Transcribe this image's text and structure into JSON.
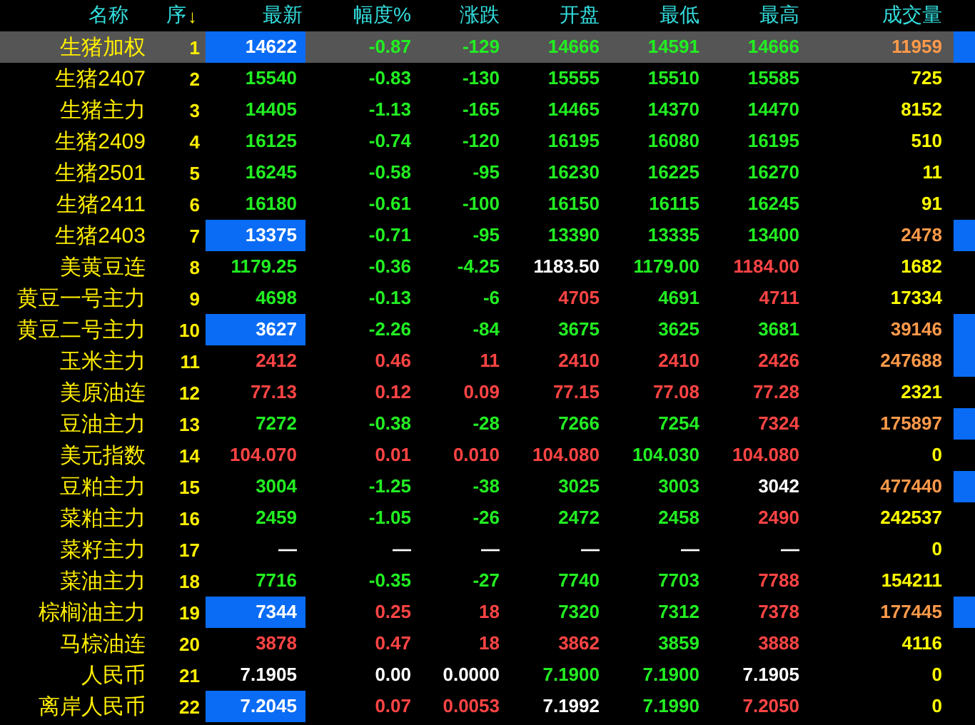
{
  "columns": [
    {
      "kind": "name",
      "label": "名称"
    },
    {
      "kind": "seq",
      "label": "序",
      "sort_arrow": "↓"
    },
    {
      "kind": "num",
      "label": "最新"
    },
    {
      "kind": "num",
      "label": "幅度%"
    },
    {
      "kind": "num",
      "label": "涨跌"
    },
    {
      "kind": "num",
      "label": "开盘"
    },
    {
      "kind": "num",
      "label": "最低"
    },
    {
      "kind": "num",
      "label": "最高"
    },
    {
      "kind": "num",
      "label": "成交量"
    }
  ],
  "rows": [
    {
      "name": "生猪加权",
      "seq": "1",
      "selected": true,
      "highlighted": true,
      "flagged": true,
      "cells": [
        {
          "text": "14622",
          "color": "#ffffff"
        },
        {
          "text": "-0.87",
          "color": "#22ee22"
        },
        {
          "text": "-129",
          "color": "#22ee22"
        },
        {
          "text": "14666",
          "color": "#22ee22"
        },
        {
          "text": "14591",
          "color": "#22ee22"
        },
        {
          "text": "14666",
          "color": "#22ee22"
        },
        {
          "text": "11959",
          "color": "#ff9a4a"
        }
      ]
    },
    {
      "name": "生猪2407",
      "seq": "2",
      "selected": false,
      "highlighted": false,
      "flagged": false,
      "cells": [
        {
          "text": "15540",
          "color": "#22ee22"
        },
        {
          "text": "-0.83",
          "color": "#22ee22"
        },
        {
          "text": "-130",
          "color": "#22ee22"
        },
        {
          "text": "15555",
          "color": "#22ee22"
        },
        {
          "text": "15510",
          "color": "#22ee22"
        },
        {
          "text": "15585",
          "color": "#22ee22"
        },
        {
          "text": "725",
          "color": "#ffff00"
        }
      ]
    },
    {
      "name": "生猪主力",
      "seq": "3",
      "selected": false,
      "highlighted": false,
      "flagged": false,
      "cells": [
        {
          "text": "14405",
          "color": "#22ee22"
        },
        {
          "text": "-1.13",
          "color": "#22ee22"
        },
        {
          "text": "-165",
          "color": "#22ee22"
        },
        {
          "text": "14465",
          "color": "#22ee22"
        },
        {
          "text": "14370",
          "color": "#22ee22"
        },
        {
          "text": "14470",
          "color": "#22ee22"
        },
        {
          "text": "8152",
          "color": "#ffff00"
        }
      ]
    },
    {
      "name": "生猪2409",
      "seq": "4",
      "selected": false,
      "highlighted": false,
      "flagged": false,
      "cells": [
        {
          "text": "16125",
          "color": "#22ee22"
        },
        {
          "text": "-0.74",
          "color": "#22ee22"
        },
        {
          "text": "-120",
          "color": "#22ee22"
        },
        {
          "text": "16195",
          "color": "#22ee22"
        },
        {
          "text": "16080",
          "color": "#22ee22"
        },
        {
          "text": "16195",
          "color": "#22ee22"
        },
        {
          "text": "510",
          "color": "#ffff00"
        }
      ]
    },
    {
      "name": "生猪2501",
      "seq": "5",
      "selected": false,
      "highlighted": false,
      "flagged": false,
      "cells": [
        {
          "text": "16245",
          "color": "#22ee22"
        },
        {
          "text": "-0.58",
          "color": "#22ee22"
        },
        {
          "text": "-95",
          "color": "#22ee22"
        },
        {
          "text": "16230",
          "color": "#22ee22"
        },
        {
          "text": "16225",
          "color": "#22ee22"
        },
        {
          "text": "16270",
          "color": "#22ee22"
        },
        {
          "text": "11",
          "color": "#ffff00"
        }
      ]
    },
    {
      "name": "生猪2411",
      "seq": "6",
      "selected": false,
      "highlighted": false,
      "flagged": false,
      "cells": [
        {
          "text": "16180",
          "color": "#22ee22"
        },
        {
          "text": "-0.61",
          "color": "#22ee22"
        },
        {
          "text": "-100",
          "color": "#22ee22"
        },
        {
          "text": "16150",
          "color": "#22ee22"
        },
        {
          "text": "16115",
          "color": "#22ee22"
        },
        {
          "text": "16245",
          "color": "#22ee22"
        },
        {
          "text": "91",
          "color": "#ffff00"
        }
      ]
    },
    {
      "name": "生猪2403",
      "seq": "7",
      "selected": false,
      "highlighted": true,
      "flagged": true,
      "cells": [
        {
          "text": "13375",
          "color": "#ffffff"
        },
        {
          "text": "-0.71",
          "color": "#22ee22"
        },
        {
          "text": "-95",
          "color": "#22ee22"
        },
        {
          "text": "13390",
          "color": "#22ee22"
        },
        {
          "text": "13335",
          "color": "#22ee22"
        },
        {
          "text": "13400",
          "color": "#22ee22"
        },
        {
          "text": "2478",
          "color": "#ff9a4a"
        }
      ]
    },
    {
      "name": "美黄豆连",
      "seq": "8",
      "selected": false,
      "highlighted": false,
      "flagged": false,
      "cells": [
        {
          "text": "1179.25",
          "color": "#22ee22"
        },
        {
          "text": "-0.36",
          "color": "#22ee22"
        },
        {
          "text": "-4.25",
          "color": "#22ee22"
        },
        {
          "text": "1183.50",
          "color": "#ffffff"
        },
        {
          "text": "1179.00",
          "color": "#22ee22"
        },
        {
          "text": "1184.00",
          "color": "#ff4444"
        },
        {
          "text": "1682",
          "color": "#ffff00"
        }
      ]
    },
    {
      "name": "黄豆一号主力",
      "seq": "9",
      "selected": false,
      "highlighted": false,
      "flagged": false,
      "cells": [
        {
          "text": "4698",
          "color": "#22ee22"
        },
        {
          "text": "-0.13",
          "color": "#22ee22"
        },
        {
          "text": "-6",
          "color": "#22ee22"
        },
        {
          "text": "4705",
          "color": "#ff4444"
        },
        {
          "text": "4691",
          "color": "#22ee22"
        },
        {
          "text": "4711",
          "color": "#ff4444"
        },
        {
          "text": "17334",
          "color": "#ffff00"
        }
      ]
    },
    {
      "name": "黄豆二号主力",
      "seq": "10",
      "selected": false,
      "highlighted": true,
      "flagged": true,
      "cells": [
        {
          "text": "3627",
          "color": "#ffffff"
        },
        {
          "text": "-2.26",
          "color": "#22ee22"
        },
        {
          "text": "-84",
          "color": "#22ee22"
        },
        {
          "text": "3675",
          "color": "#22ee22"
        },
        {
          "text": "3625",
          "color": "#22ee22"
        },
        {
          "text": "3681",
          "color": "#22ee22"
        },
        {
          "text": "39146",
          "color": "#ff9a4a"
        }
      ]
    },
    {
      "name": "玉米主力",
      "seq": "11",
      "selected": false,
      "highlighted": false,
      "flagged": true,
      "cells": [
        {
          "text": "2412",
          "color": "#ff4444"
        },
        {
          "text": "0.46",
          "color": "#ff4444"
        },
        {
          "text": "11",
          "color": "#ff4444"
        },
        {
          "text": "2410",
          "color": "#ff4444"
        },
        {
          "text": "2410",
          "color": "#ff4444"
        },
        {
          "text": "2426",
          "color": "#ff4444"
        },
        {
          "text": "247688",
          "color": "#ff9a4a"
        }
      ]
    },
    {
      "name": "美原油连",
      "seq": "12",
      "selected": false,
      "highlighted": false,
      "flagged": false,
      "cells": [
        {
          "text": "77.13",
          "color": "#ff4444"
        },
        {
          "text": "0.12",
          "color": "#ff4444"
        },
        {
          "text": "0.09",
          "color": "#ff4444"
        },
        {
          "text": "77.15",
          "color": "#ff4444"
        },
        {
          "text": "77.08",
          "color": "#ff4444"
        },
        {
          "text": "77.28",
          "color": "#ff4444"
        },
        {
          "text": "2321",
          "color": "#ffff00"
        }
      ]
    },
    {
      "name": "豆油主力",
      "seq": "13",
      "selected": false,
      "highlighted": false,
      "flagged": true,
      "cells": [
        {
          "text": "7272",
          "color": "#22ee22"
        },
        {
          "text": "-0.38",
          "color": "#22ee22"
        },
        {
          "text": "-28",
          "color": "#22ee22"
        },
        {
          "text": "7266",
          "color": "#22ee22"
        },
        {
          "text": "7254",
          "color": "#22ee22"
        },
        {
          "text": "7324",
          "color": "#ff4444"
        },
        {
          "text": "175897",
          "color": "#ff9a4a"
        }
      ]
    },
    {
      "name": "美元指数",
      "seq": "14",
      "selected": false,
      "highlighted": false,
      "flagged": false,
      "cells": [
        {
          "text": "104.070",
          "color": "#ff4444"
        },
        {
          "text": "0.01",
          "color": "#ff4444"
        },
        {
          "text": "0.010",
          "color": "#ff4444"
        },
        {
          "text": "104.080",
          "color": "#ff4444"
        },
        {
          "text": "104.030",
          "color": "#22ee22"
        },
        {
          "text": "104.080",
          "color": "#ff4444"
        },
        {
          "text": "0",
          "color": "#ffff00"
        }
      ]
    },
    {
      "name": "豆粕主力",
      "seq": "15",
      "selected": false,
      "highlighted": false,
      "flagged": true,
      "cells": [
        {
          "text": "3004",
          "color": "#22ee22"
        },
        {
          "text": "-1.25",
          "color": "#22ee22"
        },
        {
          "text": "-38",
          "color": "#22ee22"
        },
        {
          "text": "3025",
          "color": "#22ee22"
        },
        {
          "text": "3003",
          "color": "#22ee22"
        },
        {
          "text": "3042",
          "color": "#ffffff"
        },
        {
          "text": "477440",
          "color": "#ff9a4a"
        }
      ]
    },
    {
      "name": "菜粕主力",
      "seq": "16",
      "selected": false,
      "highlighted": false,
      "flagged": false,
      "cells": [
        {
          "text": "2459",
          "color": "#22ee22"
        },
        {
          "text": "-1.05",
          "color": "#22ee22"
        },
        {
          "text": "-26",
          "color": "#22ee22"
        },
        {
          "text": "2472",
          "color": "#22ee22"
        },
        {
          "text": "2458",
          "color": "#22ee22"
        },
        {
          "text": "2490",
          "color": "#ff4444"
        },
        {
          "text": "242537",
          "color": "#ffff00"
        }
      ]
    },
    {
      "name": "菜籽主力",
      "seq": "17",
      "selected": false,
      "highlighted": false,
      "flagged": false,
      "cells": [
        {
          "text": "—",
          "color": "#ffffff"
        },
        {
          "text": "—",
          "color": "#ffffff"
        },
        {
          "text": "—",
          "color": "#ffffff"
        },
        {
          "text": "—",
          "color": "#ffffff"
        },
        {
          "text": "—",
          "color": "#ffffff"
        },
        {
          "text": "—",
          "color": "#ffffff"
        },
        {
          "text": "0",
          "color": "#ffff00"
        }
      ]
    },
    {
      "name": "菜油主力",
      "seq": "18",
      "selected": false,
      "highlighted": false,
      "flagged": false,
      "cells": [
        {
          "text": "7716",
          "color": "#22ee22"
        },
        {
          "text": "-0.35",
          "color": "#22ee22"
        },
        {
          "text": "-27",
          "color": "#22ee22"
        },
        {
          "text": "7740",
          "color": "#22ee22"
        },
        {
          "text": "7703",
          "color": "#22ee22"
        },
        {
          "text": "7788",
          "color": "#ff4444"
        },
        {
          "text": "154211",
          "color": "#ffff00"
        }
      ]
    },
    {
      "name": "棕榈油主力",
      "seq": "19",
      "selected": false,
      "highlighted": true,
      "flagged": true,
      "cells": [
        {
          "text": "7344",
          "color": "#ffffff"
        },
        {
          "text": "0.25",
          "color": "#ff4444"
        },
        {
          "text": "18",
          "color": "#ff4444"
        },
        {
          "text": "7320",
          "color": "#22ee22"
        },
        {
          "text": "7312",
          "color": "#22ee22"
        },
        {
          "text": "7378",
          "color": "#ff4444"
        },
        {
          "text": "177445",
          "color": "#ff9a4a"
        }
      ]
    },
    {
      "name": "马棕油连",
      "seq": "20",
      "selected": false,
      "highlighted": false,
      "flagged": false,
      "cells": [
        {
          "text": "3878",
          "color": "#ff4444"
        },
        {
          "text": "0.47",
          "color": "#ff4444"
        },
        {
          "text": "18",
          "color": "#ff4444"
        },
        {
          "text": "3862",
          "color": "#ff4444"
        },
        {
          "text": "3859",
          "color": "#22ee22"
        },
        {
          "text": "3888",
          "color": "#ff4444"
        },
        {
          "text": "4116",
          "color": "#ffff00"
        }
      ]
    },
    {
      "name": "人民币",
      "seq": "21",
      "selected": false,
      "highlighted": false,
      "flagged": false,
      "cells": [
        {
          "text": "7.1905",
          "color": "#ffffff"
        },
        {
          "text": "0.00",
          "color": "#ffffff"
        },
        {
          "text": "0.0000",
          "color": "#ffffff"
        },
        {
          "text": "7.1900",
          "color": "#22ee22"
        },
        {
          "text": "7.1900",
          "color": "#22ee22"
        },
        {
          "text": "7.1905",
          "color": "#ffffff"
        },
        {
          "text": "0",
          "color": "#ffff00"
        }
      ]
    },
    {
      "name": "离岸人民币",
      "seq": "22",
      "selected": false,
      "highlighted": true,
      "flagged": false,
      "cells": [
        {
          "text": "7.2045",
          "color": "#ffffff"
        },
        {
          "text": "0.07",
          "color": "#ff4444"
        },
        {
          "text": "0.0053",
          "color": "#ff4444"
        },
        {
          "text": "7.1992",
          "color": "#ffffff"
        },
        {
          "text": "7.1990",
          "color": "#22ee22"
        },
        {
          "text": "7.2050",
          "color": "#ff4444"
        },
        {
          "text": "0",
          "color": "#ffff00"
        }
      ]
    }
  ]
}
